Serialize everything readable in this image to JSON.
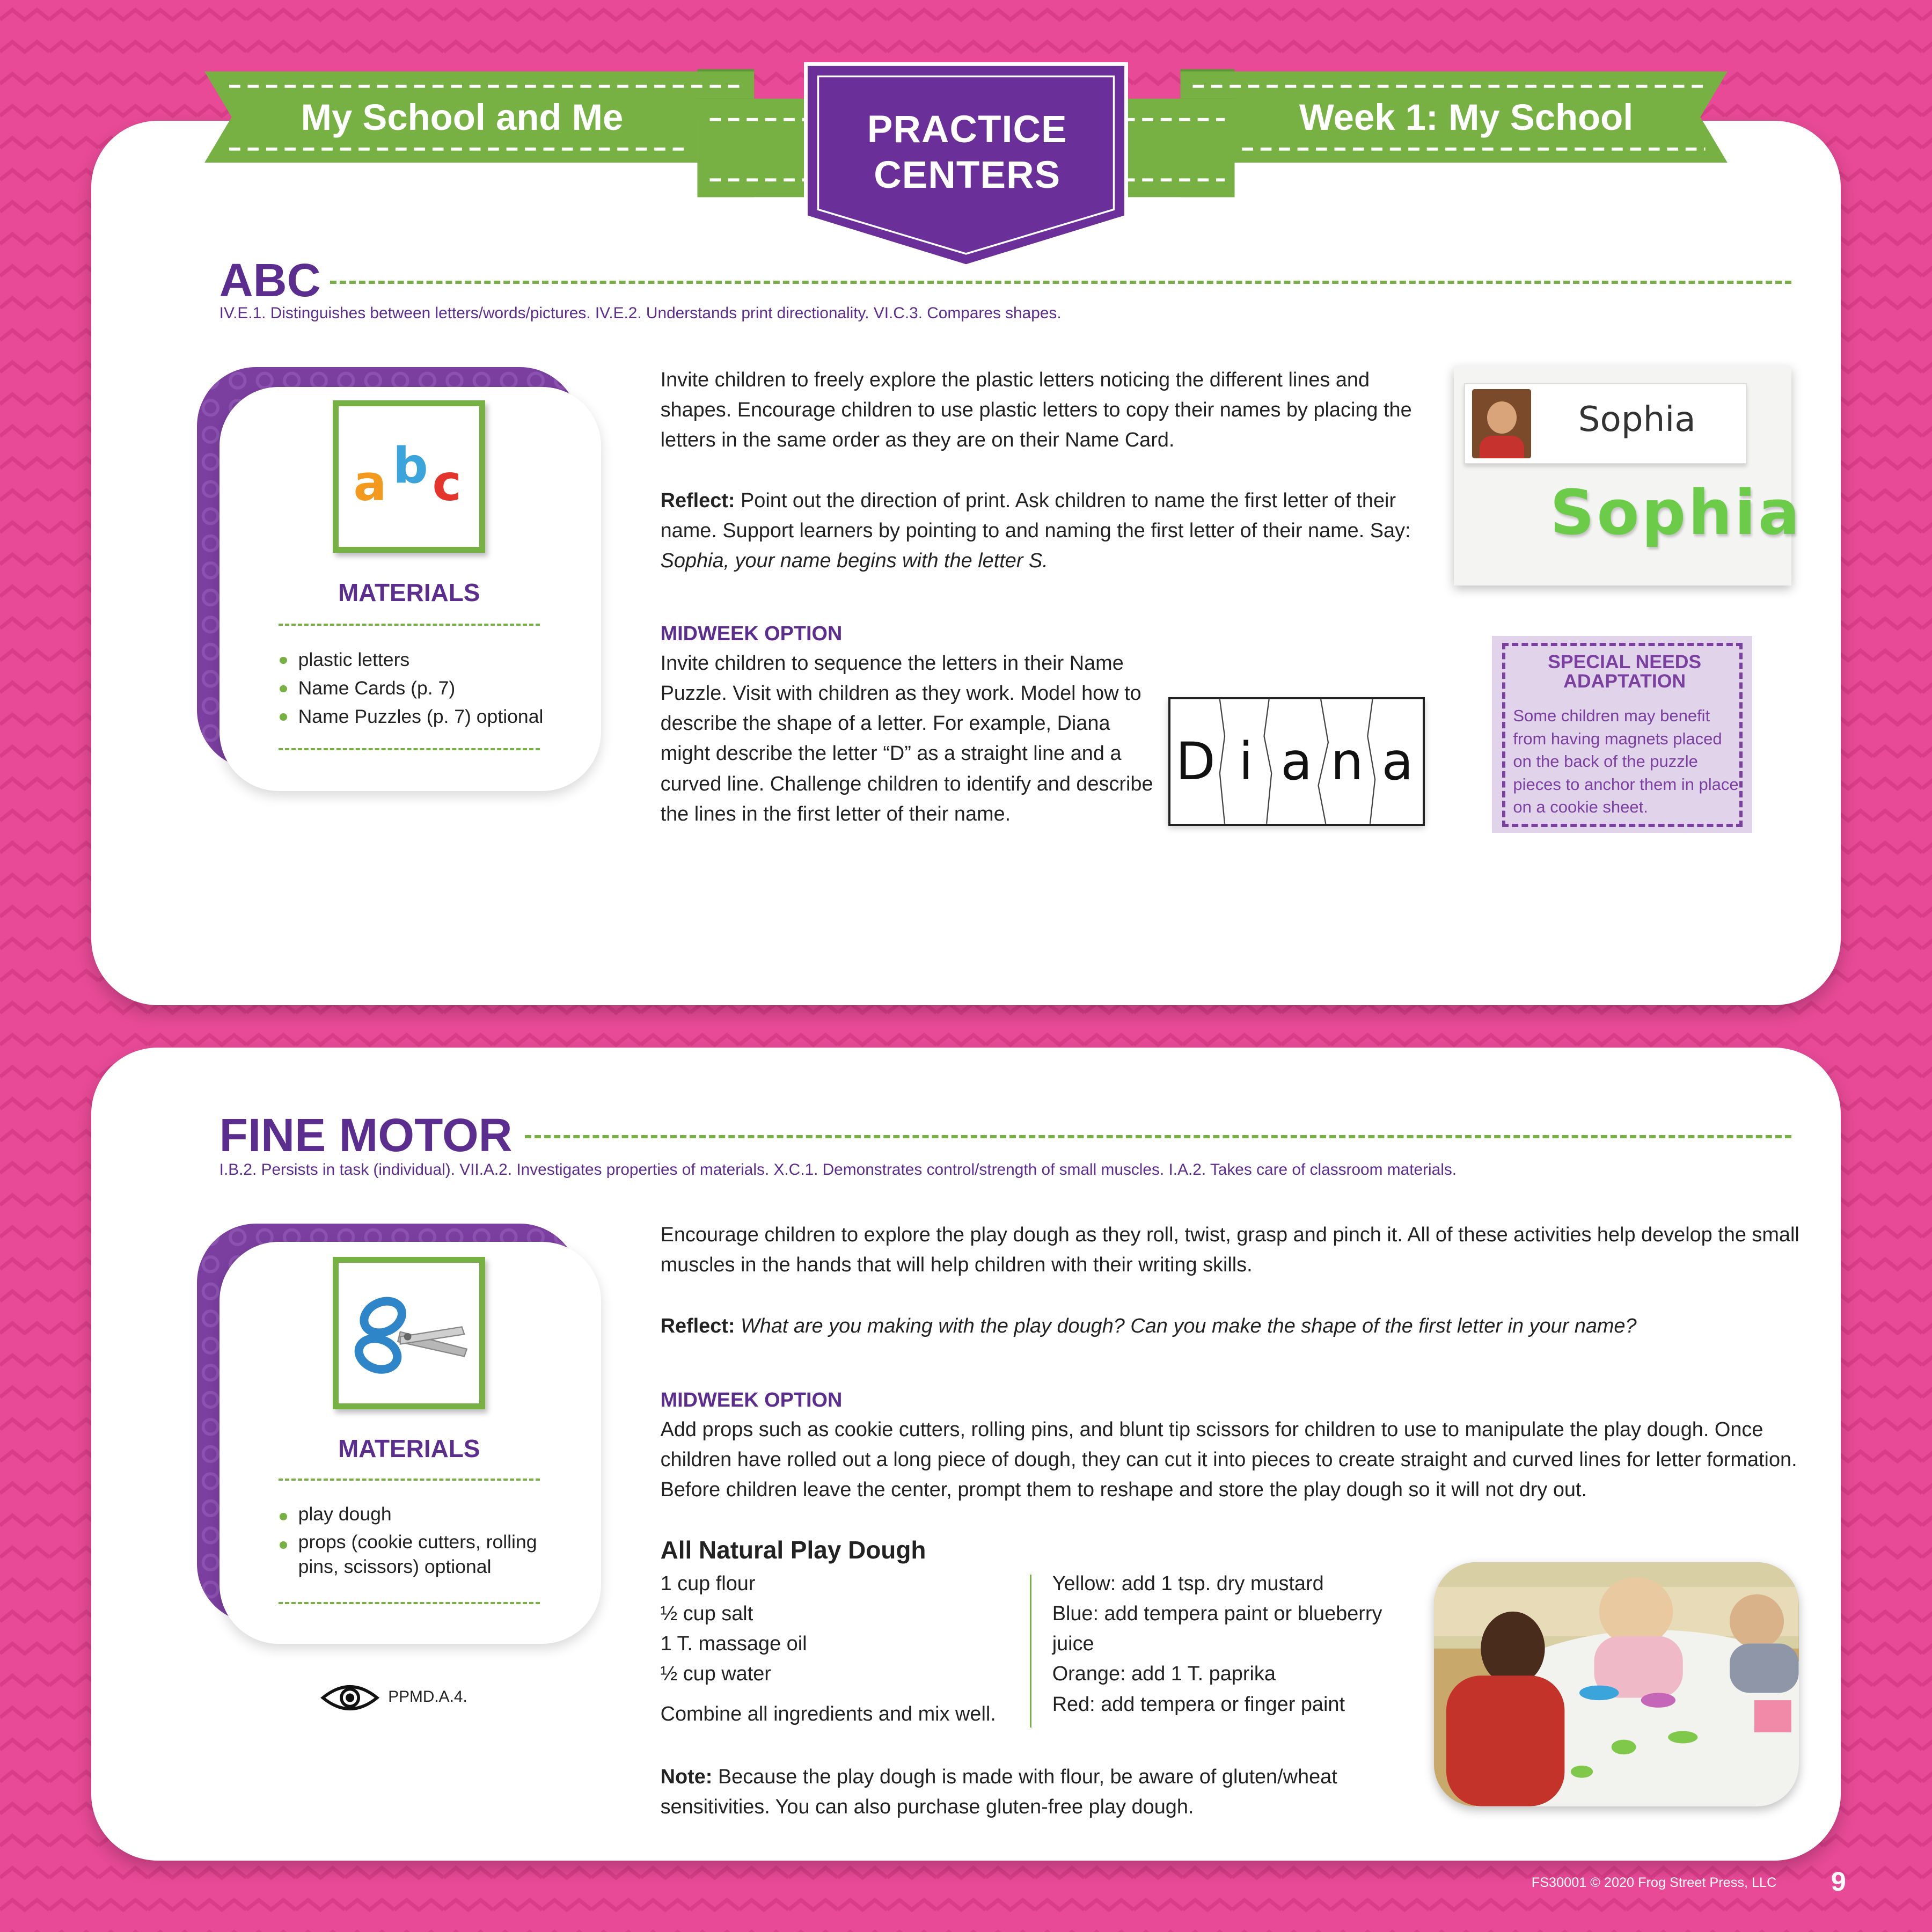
{
  "header": {
    "left_ribbon": "My School and Me",
    "badge": "PRACTICE CENTERS",
    "right_ribbon": "Week 1: My School"
  },
  "abc": {
    "title": "ABC",
    "standards": "IV.E.1. Distinguishes between letters/words/pictures. IV.E.2. Understands print directionality. VI.C.3. Compares shapes.",
    "icon": "abc-letters-icon",
    "materials_title": "MATERIALS",
    "materials": [
      "plastic letters",
      "Name Cards (p. 7)",
      "Name Puzzles (p. 7) optional"
    ],
    "intro": "Invite children to freely explore the plastic letters noticing the different lines and shapes. Encourage children to use plastic letters to copy their names by placing the letters in the same order as they are on their Name Card.",
    "reflect_label": "Reflect:",
    "reflect_text": " Point out the direction of print. Ask children to name the first letter of their name. Support learners by pointing to and naming the first letter of their name. Say: ",
    "reflect_italic": "Sophia, your name begins with the letter S.",
    "midweek_title": "MIDWEEK OPTION",
    "midweek_text": "Invite children to sequence the letters in their Name Puzzle. Visit with children as they work. Model how to describe the shape of a letter. For example, Diana might describe the letter “D” as a straight line and a curved line. Challenge children to identify and describe the lines in the first letter of their name.",
    "name_card_text": "Sophia",
    "plastic_letters_text": "Sophia",
    "puzzle_letters": [
      "D",
      "i",
      "a",
      "n",
      "a"
    ],
    "special_needs_title": "SPECIAL NEEDS ADAPTATION",
    "special_needs_text": "Some children may benefit from having magnets placed on the back of the puzzle pieces to anchor them in place on a cookie sheet."
  },
  "fine_motor": {
    "title": "FINE MOTOR",
    "standards": "I.B.2. Persists in task (individual). VII.A.2. Investigates properties of materials. X.C.1. Demonstrates control/strength of small muscles. I.A.2. Takes care of classroom materials.",
    "icon": "scissors-icon",
    "materials_title": "MATERIALS",
    "materials": [
      "play dough",
      "props (cookie cutters, rolling pins, scissors) optional"
    ],
    "eye_code": "PPMD.A.4.",
    "intro": "Encourage children to explore the play dough as they roll, twist, grasp and pinch it. All of these activities help develop the small muscles in the hands that will help children with their writing skills.",
    "reflect_label": "Reflect:",
    "reflect_italic": " What are you making with the play dough? Can you make the shape of the first letter in your name?",
    "midweek_title": "MIDWEEK OPTION",
    "midweek_text": "Add props such as cookie cutters, rolling pins, and blunt tip scissors for children to use to manipulate the play dough. Once children have rolled out a long piece of dough, they can cut it into pieces to create straight and curved lines for letter formation. Before children leave the center, prompt them to reshape and store the play dough so it will not dry out.",
    "recipe_title": "All Natural Play Dough",
    "recipe_left": [
      "1 cup flour",
      "½ cup salt",
      "1 T. massage oil",
      "½ cup water"
    ],
    "recipe_combine": "Combine all ingredients and mix well.",
    "recipe_right": [
      "Yellow: add 1 tsp. dry mustard",
      "Blue: add tempera paint or blueberry juice",
      "Orange: add 1 T. paprika",
      "Red: add tempera or finger paint"
    ],
    "note_label": "Note:",
    "note_text": " Because the play dough is made with flour, be aware of gluten/wheat sensitivities. You can also purchase gluten-free play dough."
  },
  "footer": {
    "copyright": "FS30001 © 2020 Frog Street Press, LLC",
    "page_number": "9"
  },
  "colors": {
    "background": "#e84a97",
    "green": "#77b043",
    "purple": "#5b2d8e",
    "badge_purple": "#6b2f99"
  }
}
